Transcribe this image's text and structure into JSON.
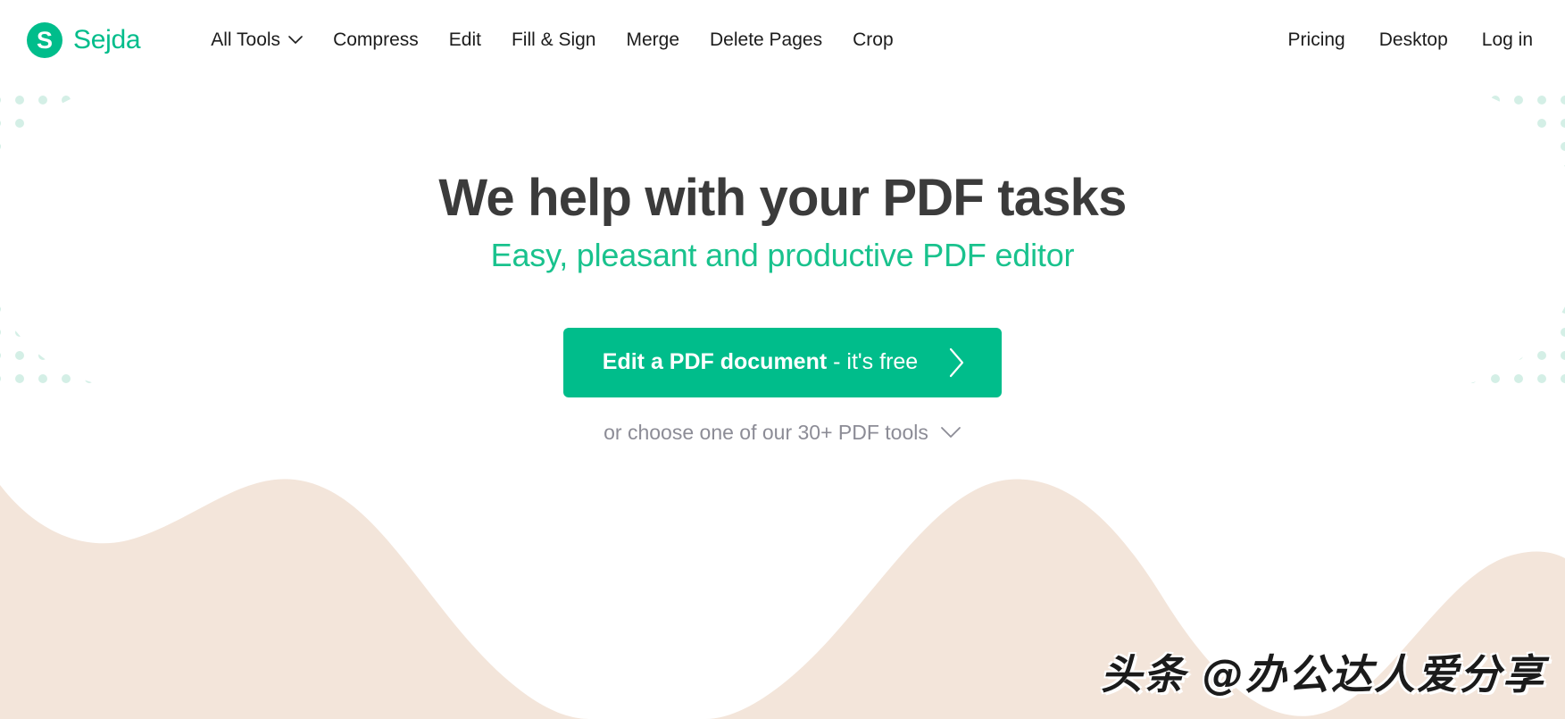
{
  "brand": {
    "mark_letter": "S",
    "name": "Sejda"
  },
  "nav": {
    "left_items": [
      {
        "label": "All Tools",
        "icon": "chevron-down-icon",
        "has_chevron": true
      },
      {
        "label": "Compress",
        "has_chevron": false
      },
      {
        "label": "Edit",
        "has_chevron": false
      },
      {
        "label": "Fill & Sign",
        "has_chevron": false
      },
      {
        "label": "Merge",
        "has_chevron": false
      },
      {
        "label": "Delete Pages",
        "has_chevron": false
      },
      {
        "label": "Crop",
        "has_chevron": false
      }
    ],
    "right_items": [
      {
        "label": "Pricing"
      },
      {
        "label": "Desktop"
      },
      {
        "label": "Log in"
      }
    ]
  },
  "hero": {
    "title": "We help with your PDF tasks",
    "subtitle": "Easy, pleasant and productive PDF editor",
    "cta": {
      "label_strong": "Edit a PDF document",
      "label_rest": " - it's free",
      "icon": "chevron-right-icon"
    },
    "secondary": {
      "label": "or choose one of our 30+ PDF tools",
      "icon": "chevron-down-icon"
    }
  },
  "watermark": {
    "text": "头条 @办公达人爱分享"
  },
  "colors": {
    "brand_green": "#00bd8b",
    "subtitle_green": "#19c28d",
    "heading_dark": "#3b3b3b",
    "muted_text": "#8c8c96",
    "wave_beige": "#f3e5da",
    "dot_mint": "#d4efe6",
    "background": "#ffffff"
  }
}
